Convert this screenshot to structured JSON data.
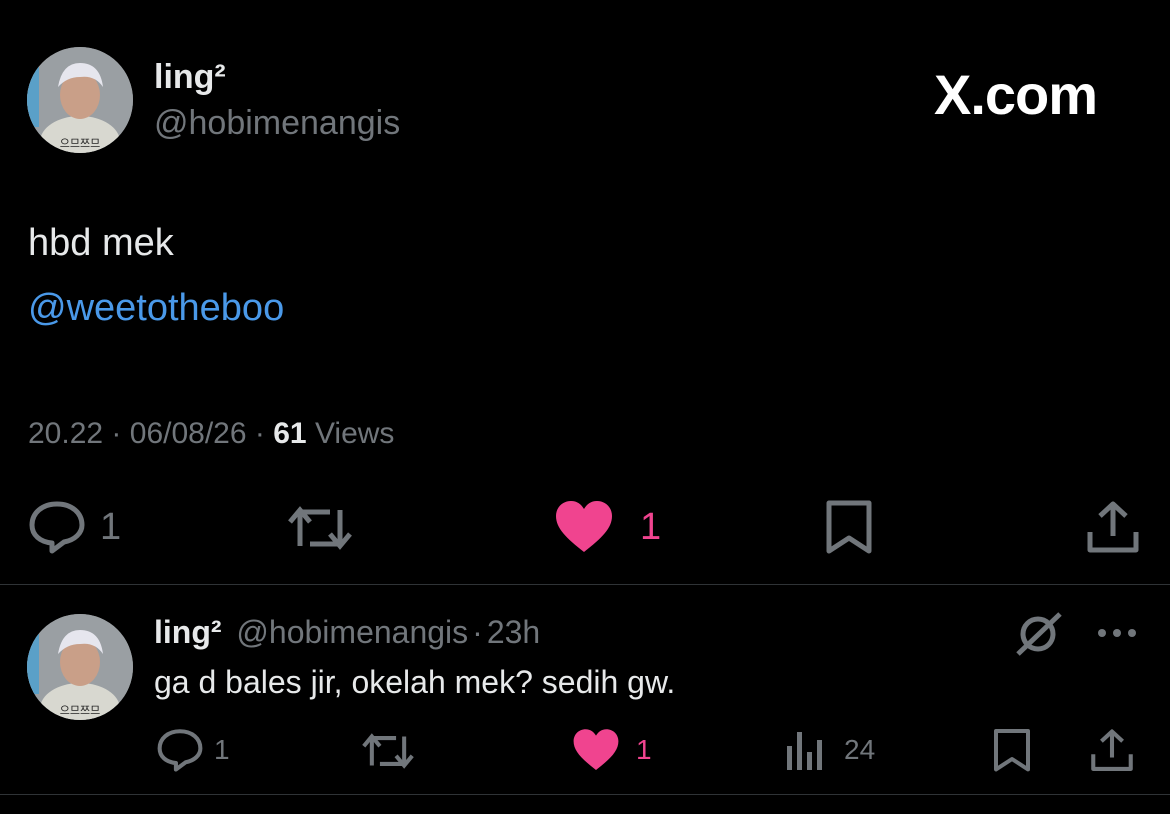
{
  "main_tweet": {
    "display_name": "ling²",
    "handle": "@hobimenangis",
    "brand": "X.com",
    "text": "hbd mek",
    "mention": "@weetotheboo",
    "time": "20.22",
    "sep1": "·",
    "date": "06/08/26",
    "sep2": "·",
    "views_count": "61",
    "views_label": "Views",
    "actions": {
      "reply_count": "1",
      "like_count": "1",
      "liked": true
    }
  },
  "reply": {
    "display_name": "ling²",
    "handle": "@hobimenangis",
    "sep": "·",
    "time": "23h",
    "text": "ga d bales jir, okelah mek? sedih gw.",
    "actions": {
      "reply_count": "1",
      "like_count": "1",
      "views_count": "24",
      "liked": true
    }
  },
  "icons": {
    "reply": "speech-bubble-icon",
    "retweet": "repost-icon",
    "like": "heart-icon",
    "bookmark": "bookmark-icon",
    "share": "share-icon",
    "views": "bar-chart-icon",
    "grok": "grok-icon",
    "more": "more-icon"
  },
  "colors": {
    "background": "#000000",
    "text": "#e7e9ea",
    "muted": "#71767b",
    "link": "#4a99e9",
    "like": "#f0448f",
    "divider": "#2f3336"
  }
}
